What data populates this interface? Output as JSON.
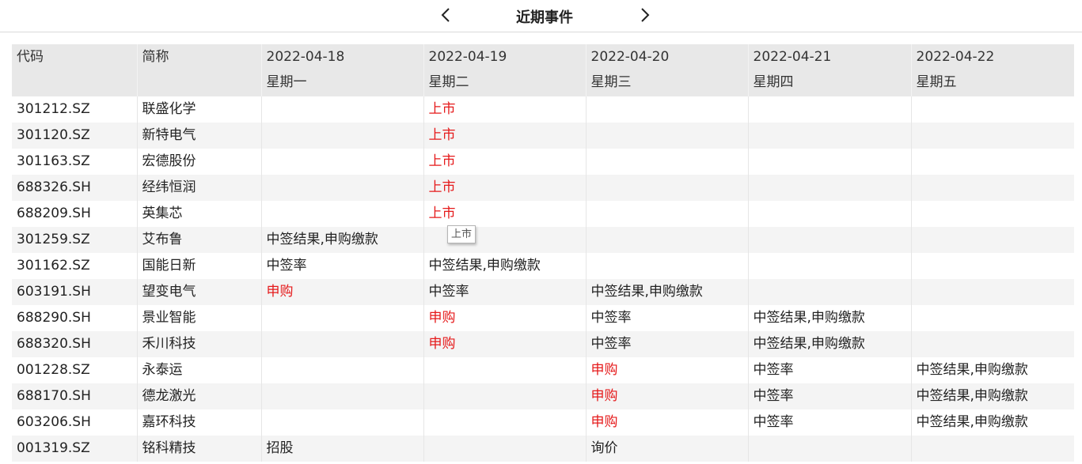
{
  "header": {
    "title": "近期事件",
    "prev_icon": "chevron-left-icon",
    "next_icon": "chevron-right-icon"
  },
  "table": {
    "columns": [
      {
        "line1": "代码",
        "line2": ""
      },
      {
        "line1": "简称",
        "line2": ""
      },
      {
        "line1": "2022-04-18",
        "line2": "星期一"
      },
      {
        "line1": "2022-04-19",
        "line2": "星期二"
      },
      {
        "line1": "2022-04-20",
        "line2": "星期三"
      },
      {
        "line1": "2022-04-21",
        "line2": "星期四"
      },
      {
        "line1": "2022-04-22",
        "line2": "星期五"
      }
    ],
    "rows": [
      {
        "code": "301212.SZ",
        "name": "联盛化学",
        "d": [
          [
            "",
            0
          ],
          [
            "上市",
            1
          ],
          [
            "",
            0
          ],
          [
            "",
            0
          ],
          [
            "",
            0
          ]
        ]
      },
      {
        "code": "301120.SZ",
        "name": "新特电气",
        "d": [
          [
            "",
            0
          ],
          [
            "上市",
            1
          ],
          [
            "",
            0
          ],
          [
            "",
            0
          ],
          [
            "",
            0
          ]
        ]
      },
      {
        "code": "301163.SZ",
        "name": "宏德股份",
        "d": [
          [
            "",
            0
          ],
          [
            "上市",
            1
          ],
          [
            "",
            0
          ],
          [
            "",
            0
          ],
          [
            "",
            0
          ]
        ]
      },
      {
        "code": "688326.SH",
        "name": "经纬恒润",
        "d": [
          [
            "",
            0
          ],
          [
            "上市",
            1
          ],
          [
            "",
            0
          ],
          [
            "",
            0
          ],
          [
            "",
            0
          ]
        ]
      },
      {
        "code": "688209.SH",
        "name": "英集芯",
        "d": [
          [
            "",
            0
          ],
          [
            "上市",
            1
          ],
          [
            "",
            0
          ],
          [
            "",
            0
          ],
          [
            "",
            0
          ]
        ]
      },
      {
        "code": "301259.SZ",
        "name": "艾布鲁",
        "d": [
          [
            "中签结果,申购缴款",
            0
          ],
          [
            "",
            0
          ],
          [
            "",
            0
          ],
          [
            "",
            0
          ],
          [
            "",
            0
          ]
        ]
      },
      {
        "code": "301162.SZ",
        "name": "国能日新",
        "d": [
          [
            "中签率",
            0
          ],
          [
            "中签结果,申购缴款",
            0
          ],
          [
            "",
            0
          ],
          [
            "",
            0
          ],
          [
            "",
            0
          ]
        ]
      },
      {
        "code": "603191.SH",
        "name": "望变电气",
        "d": [
          [
            "申购",
            1
          ],
          [
            "中签率",
            0
          ],
          [
            "中签结果,申购缴款",
            0
          ],
          [
            "",
            0
          ],
          [
            "",
            0
          ]
        ]
      },
      {
        "code": "688290.SH",
        "name": "景业智能",
        "d": [
          [
            "",
            0
          ],
          [
            "申购",
            1
          ],
          [
            "中签率",
            0
          ],
          [
            "中签结果,申购缴款",
            0
          ],
          [
            "",
            0
          ]
        ]
      },
      {
        "code": "688320.SH",
        "name": "禾川科技",
        "d": [
          [
            "",
            0
          ],
          [
            "申购",
            1
          ],
          [
            "中签率",
            0
          ],
          [
            "中签结果,申购缴款",
            0
          ],
          [
            "",
            0
          ]
        ]
      },
      {
        "code": "001228.SZ",
        "name": "永泰运",
        "d": [
          [
            "",
            0
          ],
          [
            "",
            0
          ],
          [
            "申购",
            1
          ],
          [
            "中签率",
            0
          ],
          [
            "中签结果,申购缴款",
            0
          ]
        ]
      },
      {
        "code": "688170.SH",
        "name": "德龙激光",
        "d": [
          [
            "",
            0
          ],
          [
            "",
            0
          ],
          [
            "申购",
            1
          ],
          [
            "中签率",
            0
          ],
          [
            "中签结果,申购缴款",
            0
          ]
        ]
      },
      {
        "code": "603206.SH",
        "name": "嘉环科技",
        "d": [
          [
            "",
            0
          ],
          [
            "",
            0
          ],
          [
            "申购",
            1
          ],
          [
            "中签率",
            0
          ],
          [
            "中签结果,申购缴款",
            0
          ]
        ]
      },
      {
        "code": "001319.SZ",
        "name": "铭科精技",
        "d": [
          [
            "招股",
            0
          ],
          [
            "",
            0
          ],
          [
            "询价",
            0
          ],
          [
            "",
            0
          ],
          [
            "",
            0
          ]
        ]
      }
    ]
  },
  "tooltip": {
    "text": "上市"
  },
  "colors": {
    "highlight": "#e5191a",
    "header_bg": "#e8e8e8",
    "stripe": "#f4f4f4"
  }
}
